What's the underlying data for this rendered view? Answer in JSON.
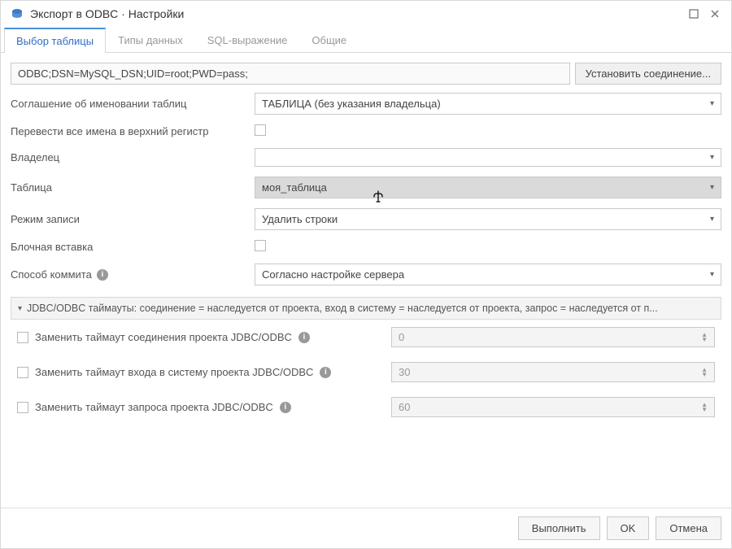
{
  "title": "Экспорт в ODBC · Настройки",
  "tabs": [
    "Выбор таблицы",
    "Типы данных",
    "SQL-выражение",
    "Общие"
  ],
  "conn": {
    "string": "ODBC;DSN=MySQL_DSN;UID=root;PWD=pass;",
    "button": "Установить соединение..."
  },
  "fields": {
    "naming_label": "Соглашение об именовании таблиц",
    "naming_value": "ТАБЛИЦА (без указания владельца)",
    "uppercase_label": "Перевести все имена в верхний регистр",
    "owner_label": "Владелец",
    "owner_value": "",
    "table_label": "Таблица",
    "table_value": "моя_таблица",
    "write_label": "Режим записи",
    "write_value": "Удалить строки",
    "block_label": "Блочная вставка",
    "commit_label": "Способ коммита",
    "commit_value": "Согласно настройке сервера"
  },
  "timeouts": {
    "header": "JDBC/ODBC таймауты: соединение = наследуется от проекта, вход в систему = наследуется от проекта, запрос = наследуется от п...",
    "rows": [
      {
        "label": "Заменить таймаут соединения проекта JDBC/ODBC",
        "value": "0"
      },
      {
        "label": "Заменить таймаут входа в систему проекта JDBC/ODBC",
        "value": "30"
      },
      {
        "label": "Заменить таймаут запроса проекта JDBC/ODBC",
        "value": "60"
      }
    ]
  },
  "footer": {
    "execute": "Выполнить",
    "ok": "OK",
    "cancel": "Отмена"
  }
}
